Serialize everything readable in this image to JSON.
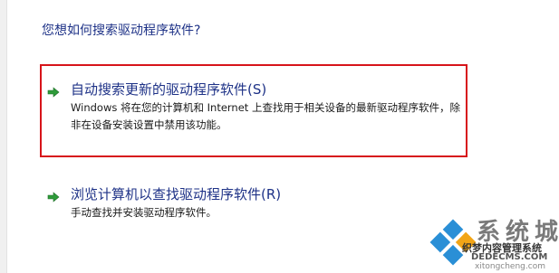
{
  "question": "您想如何搜索驱动程序软件?",
  "options": [
    {
      "title": "自动搜索更新的驱动程序软件(S)",
      "description": "Windows 将在您的计算机和 Internet 上查找用于相关设备的最新驱动程序软件，除非在设备安装设置中禁用该功能。",
      "icon": "green-arrow-icon"
    },
    {
      "title": "浏览计算机以查找驱动程序软件(R)",
      "description": "手动查找并安装驱动程序软件。",
      "icon": "green-arrow-icon"
    }
  ],
  "watermark": {
    "title": "系统城",
    "subtitle": "织梦内容管理系统",
    "domain": "DEDECMS.COM",
    "site": "xitongcheng.com"
  },
  "colors": {
    "link_blue": "#1e3287",
    "highlight_red": "#d7141a",
    "arrow_green": "#2e9b3a"
  }
}
